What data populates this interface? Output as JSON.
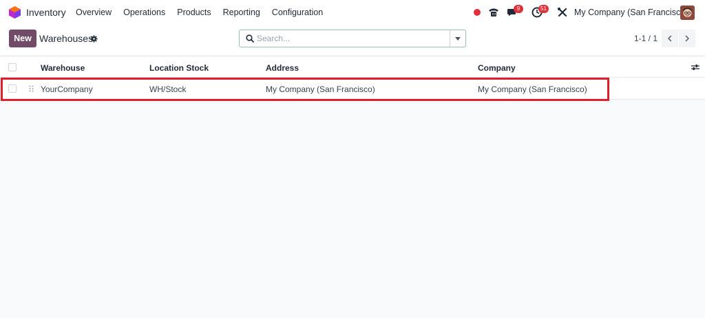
{
  "app": {
    "name": "Inventory"
  },
  "menu": [
    "Overview",
    "Operations",
    "Products",
    "Reporting",
    "Configuration"
  ],
  "systray": {
    "messages_badge": "9",
    "activities_badge": "51",
    "company": "My Company (San Francisco)"
  },
  "control": {
    "new_label": "New",
    "title": "Warehouses",
    "search_placeholder": "Search...",
    "pager": "1-1 / 1"
  },
  "table": {
    "columns": [
      "Warehouse",
      "Location Stock",
      "Address",
      "Company"
    ],
    "rows": [
      {
        "warehouse": "YourCompany",
        "location_stock": "WH/Stock",
        "address": "My Company (San Francisco)",
        "company": "My Company (San Francisco)"
      }
    ]
  },
  "colors": {
    "brand": "#714b67",
    "badge": "#e0313b",
    "highlight": "#e41d2d"
  },
  "icons": [
    "app-logo-icon",
    "phone-icon",
    "chat-icon",
    "clock-icon",
    "tools-icon",
    "gear-icon",
    "search-icon",
    "caret-down-icon",
    "chevron-left-icon",
    "chevron-right-icon",
    "drag-handle-icon",
    "sliders-icon"
  ]
}
